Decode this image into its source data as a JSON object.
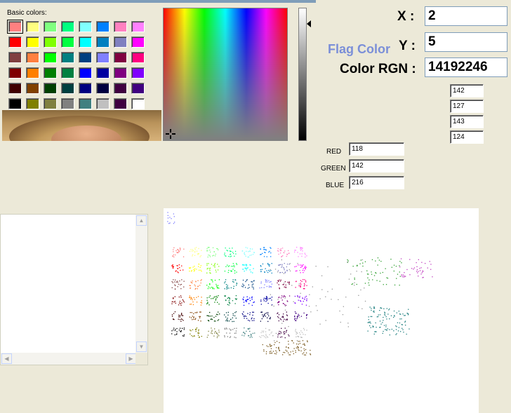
{
  "dialog": {
    "basic_colors_label": "Basic colors:",
    "swatches": [
      [
        "#FF8080",
        "#FFFF80",
        "#80FF80",
        "#00FF80",
        "#80FFFF",
        "#0080FF",
        "#FF80C0",
        "#FF80FF"
      ],
      [
        "#FF0000",
        "#FFFF00",
        "#80FF00",
        "#00FF40",
        "#00FFFF",
        "#0080C0",
        "#8080C0",
        "#FF00FF"
      ],
      [
        "#804040",
        "#FF8040",
        "#00FF00",
        "#008080",
        "#004080",
        "#8080FF",
        "#800040",
        "#FF0080"
      ],
      [
        "#800000",
        "#FF8000",
        "#008000",
        "#008040",
        "#0000FF",
        "#0000A0",
        "#800080",
        "#8000FF"
      ],
      [
        "#400000",
        "#804000",
        "#004000",
        "#004040",
        "#000080",
        "#000040",
        "#400040",
        "#400080"
      ],
      [
        "#000000",
        "#808000",
        "#808040",
        "#808080",
        "#408080",
        "#C0C0C0",
        "#400040",
        "#FFFFFF"
      ]
    ],
    "selected_swatch": "#FF8080"
  },
  "panel": {
    "x_label": "X :",
    "x_value": "2",
    "y_label": "Y :",
    "y_value": "5",
    "flag_label": "Flag Color",
    "rgn_label": "Color RGN :",
    "rgn_value": "14192246",
    "small_values": [
      "142",
      "127",
      "143",
      "124"
    ],
    "red_label": "RED",
    "red_value": "118",
    "green_label": "GREEN",
    "green_value": "142",
    "blue_label": "BLUE",
    "blue_value": "216"
  },
  "listbox": {
    "up_arrow": "▲",
    "down_arrow": "▼",
    "left_arrow": "◀",
    "right_arrow": "▶"
  }
}
